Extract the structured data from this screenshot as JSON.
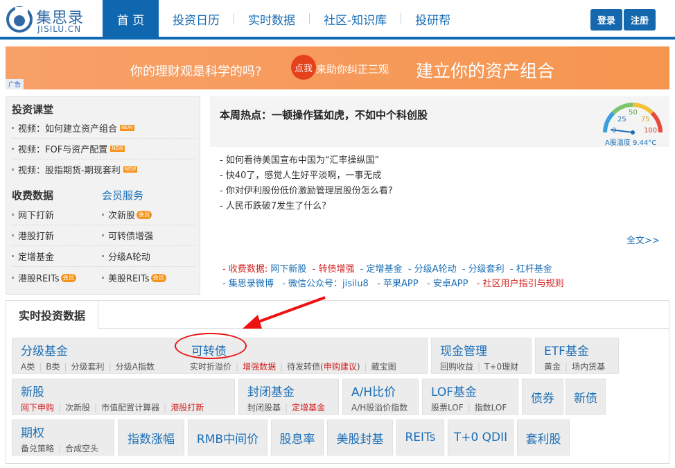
{
  "header": {
    "logo_cn": "集思录",
    "logo_en": "JISILU.CN",
    "nav": [
      "首 页",
      "投资日历",
      "实时数据",
      "社区-知识库",
      "投研帮"
    ],
    "login": "登录",
    "register": "注册"
  },
  "banner": {
    "text1": "你的理财观是科学的吗?",
    "circle": "点我",
    "text2": "来助你纠正三观",
    "text3": "建立你的资产组合",
    "ad_label": "广告"
  },
  "left": {
    "section1_title": "投资课堂",
    "courses": [
      "视频：如何建立资产组合",
      "视频：FOF与资产配置",
      "视频：股指期货-期现套利"
    ],
    "new_badge": "NEW",
    "paid_title": "收费数据",
    "member_title": "会员服务",
    "paid_items": [
      "网下打新",
      "港股打新",
      "定增基金",
      "港股REITs"
    ],
    "member_items": [
      "次新股",
      "可转债增强",
      "分级A轮动",
      "美股REITs"
    ],
    "vip_badge": "会员"
  },
  "hot": {
    "title": "本周热点：一顿操作猛如虎，不如中个科创股",
    "items": [
      "- 如何看待美国宣布中国为“汇率操纵国”",
      "- 快40了，感觉人生好平淡啊，一事无成",
      "- 你对伊利股份低价激励管理层股份怎么看?",
      "- 人民币跌破7发生了什么?"
    ],
    "full": "全文>>",
    "gauge_labels": [
      "0",
      "25",
      "50",
      "75",
      "100"
    ],
    "gauge_caption": "A股温度 9.44°C",
    "row1_lead": "- 收费数据:",
    "row1": [
      "网下新股",
      "- 转债增强",
      "- 定增基金",
      "- 分级A轮动",
      "- 分级套利",
      "- 杠杆基金"
    ],
    "row2": [
      "- 集思录微博",
      "- 微信公众号：jisilu8",
      "- 苹果APP",
      "- 安卓APP",
      "- 社区用户指引与规则"
    ]
  },
  "realtime": {
    "tab": "实时投资数据",
    "fenji": {
      "title": "分级基金",
      "subs": [
        "A类",
        "B类",
        "分级套利",
        "分级A指数"
      ]
    },
    "kzz": {
      "title": "可转债",
      "subs": [
        "实时折溢价",
        "增强数据",
        "待发转债(",
        "申购建议",
        ")",
        "藏宝图"
      ]
    },
    "cash": {
      "title": "现金管理",
      "subs": [
        "回购收益",
        "T+0理财"
      ]
    },
    "etf": {
      "title": "ETF基金",
      "subs": [
        "黄金",
        "场内货基"
      ]
    },
    "newstock": {
      "title": "新股",
      "subs": [
        "网下申购",
        "次新股",
        "市值配置计算器",
        "港股打新"
      ]
    },
    "closed": {
      "title": "封闭基金",
      "subs": [
        "封闭股基",
        "定增基金"
      ]
    },
    "ah": {
      "title": "A/H比价",
      "subs": [
        "A/H股溢价指数"
      ]
    },
    "lof": {
      "title": "LOF基金",
      "subs": [
        "股票LOF",
        "指数LOF"
      ]
    },
    "bond": "债券",
    "newbond": "新债",
    "option": {
      "title": "期权",
      "subs": [
        "备兑策略",
        "合成空头"
      ]
    },
    "row3": [
      "指数涨幅",
      "RMB中间价",
      "股息率",
      "美股封基",
      "REITs",
      "T+0 QDII",
      "套利股"
    ]
  },
  "colors": {
    "brand": "#0f67b0",
    "link": "#1a6eb6",
    "highlight": "#d31f1f",
    "annotation": "#e11111"
  }
}
